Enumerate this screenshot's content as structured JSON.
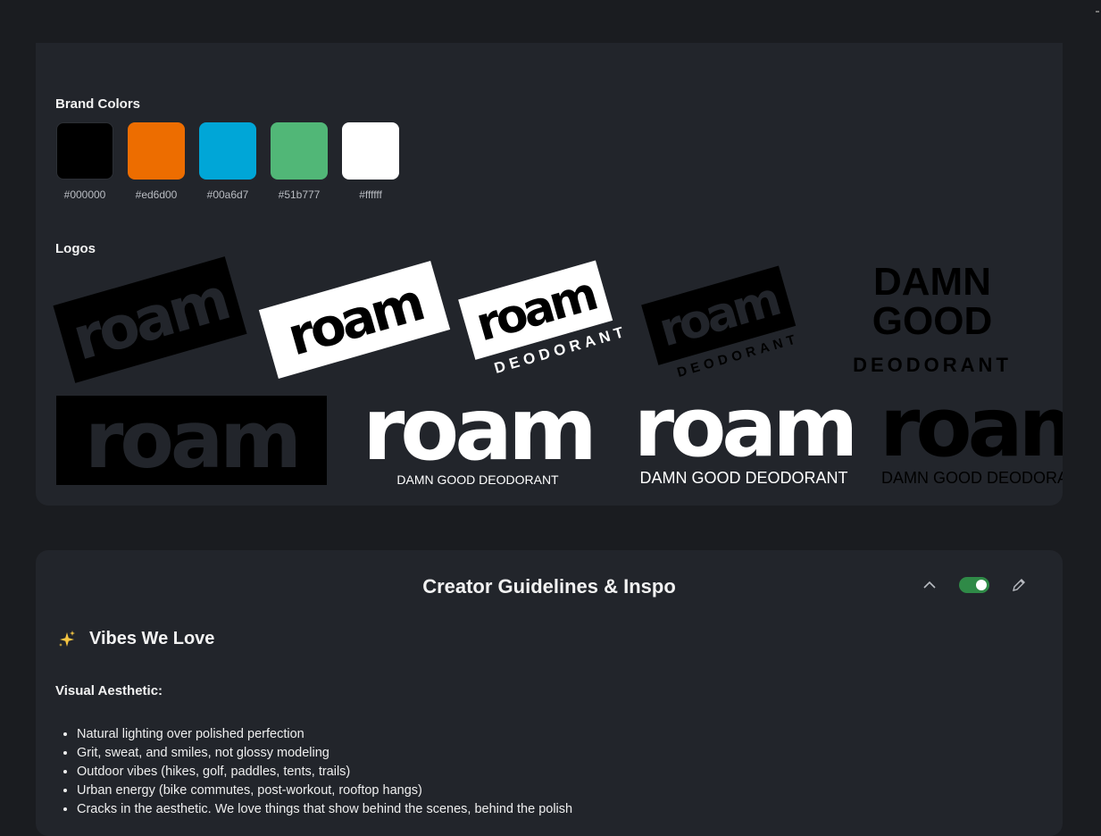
{
  "brand": {
    "colors_label": "Brand Colors",
    "logos_label": "Logos",
    "colors": [
      {
        "hex": "#000000",
        "label": "#000000"
      },
      {
        "hex": "#ed6d00",
        "label": "#ed6d00"
      },
      {
        "hex": "#00a6d7",
        "label": "#00a6d7"
      },
      {
        "hex": "#51b777",
        "label": "#51b777"
      },
      {
        "hex": "#ffffff",
        "label": "#ffffff"
      }
    ],
    "logos": {
      "roam": "roam",
      "deodorant": "DEODORANT",
      "damn": "DAMN",
      "good": "GOOD",
      "tagline": "DAMN GOOD DEODORANT"
    }
  },
  "guidelines": {
    "title": "Creator Guidelines & Inspo",
    "vibes_heading": "Vibes We Love",
    "visual_label": "Visual Aesthetic:",
    "bullets": [
      "Natural lighting over polished perfection",
      "Grit, sweat, and smiles, not glossy modeling",
      "Outdoor vibes (hikes, golf, paddles, tents, trails)",
      "Urban energy (bike commutes, post-workout, rooftop hangs)",
      "Cracks in the aesthetic. We love things that show behind the scenes, behind the polish"
    ]
  }
}
